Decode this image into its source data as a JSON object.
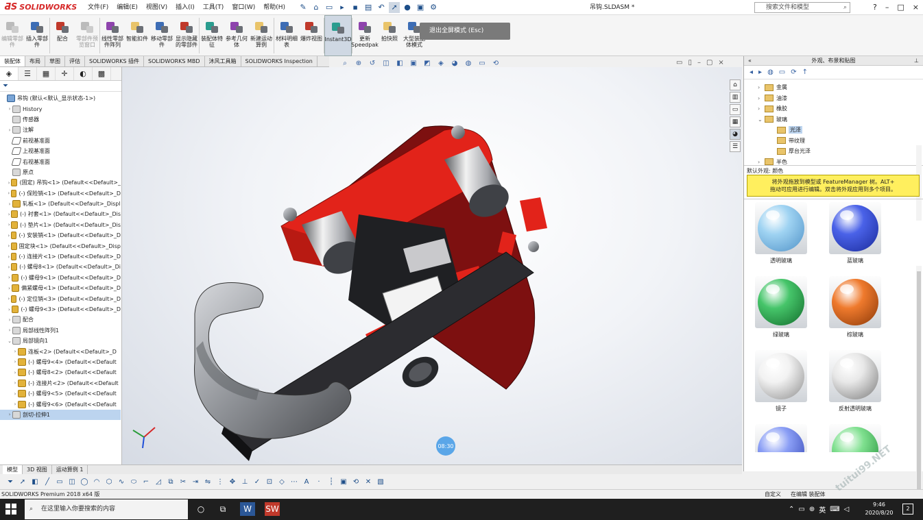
{
  "app": {
    "brand": "SOLIDWORKS",
    "doc_title": "吊钩.SLDASM *"
  },
  "menu": [
    "文件(F)",
    "编辑(E)",
    "视图(V)",
    "插入(I)",
    "工具(T)",
    "窗口(W)",
    "帮助(H)"
  ],
  "search": {
    "placeholder": "搜索文件和模型"
  },
  "win_controls": [
    "?",
    "–",
    "□",
    "×"
  ],
  "ribbon": [
    {
      "label": "编辑零部件",
      "enabled": false
    },
    {
      "label": "插入零部件",
      "enabled": true
    },
    {
      "label": "配合",
      "enabled": true
    },
    {
      "label": "零部件预览窗口",
      "enabled": false
    },
    {
      "label": "线性零部件阵列",
      "enabled": true
    },
    {
      "label": "智能扣件",
      "enabled": true
    },
    {
      "label": "移动零部件",
      "enabled": true
    },
    {
      "label": "显示隐藏的零部件",
      "enabled": true
    },
    {
      "label": "装配体特征",
      "enabled": true
    },
    {
      "label": "参考几何体",
      "enabled": true
    },
    {
      "label": "新建运动算例",
      "enabled": true
    },
    {
      "label": "材料明细表",
      "enabled": true
    },
    {
      "label": "爆炸视图",
      "enabled": true
    },
    {
      "label": "Instant3D",
      "enabled": true
    },
    {
      "label": "更新Speedpak",
      "enabled": true
    },
    {
      "label": "拍快照",
      "enabled": true
    },
    {
      "label": "大型装配体模式",
      "enabled": true
    }
  ],
  "tooltip": "退出全屏模式 (Esc)",
  "cm_tabs": [
    "装配体",
    "布局",
    "草图",
    "评估",
    "SOLIDWORKS 插件",
    "SOLIDWORKS MBD",
    "沐风工具箱",
    "SOLIDWORKS Inspection"
  ],
  "tree": [
    {
      "label": "吊钩 (默认<默认_显示状态-1>)",
      "icon": "asm",
      "indent": 0,
      "arrow": "",
      "selected": false
    },
    {
      "label": "History",
      "icon": "folder",
      "indent": 1,
      "arrow": "›",
      "selected": false
    },
    {
      "label": "传感器",
      "icon": "folder",
      "indent": 1,
      "arrow": "",
      "selected": false
    },
    {
      "label": "注解",
      "icon": "folder",
      "indent": 1,
      "arrow": "›",
      "selected": false
    },
    {
      "label": "前视基准面",
      "icon": "plane",
      "indent": 1,
      "arrow": "",
      "selected": false
    },
    {
      "label": "上视基准面",
      "icon": "plane",
      "indent": 1,
      "arrow": "",
      "selected": false
    },
    {
      "label": "右视基准面",
      "icon": "plane",
      "indent": 1,
      "arrow": "",
      "selected": false
    },
    {
      "label": "原点",
      "icon": "folder",
      "indent": 1,
      "arrow": "",
      "selected": false
    },
    {
      "label": "(固定) 吊钩<1> (Default<<Default>_",
      "icon": "part",
      "indent": 1,
      "arrow": "›",
      "selected": false
    },
    {
      "label": "(-) 保险销<1> (Default<<Default>_D",
      "icon": "part",
      "indent": 1,
      "arrow": "›",
      "selected": false
    },
    {
      "label": "轧板<1> (Default<<Default>_Displ",
      "icon": "part",
      "indent": 1,
      "arrow": "›",
      "selected": false
    },
    {
      "label": "(-) 衬套<1> (Default<<Default>_Dis",
      "icon": "part",
      "indent": 1,
      "arrow": "›",
      "selected": false
    },
    {
      "label": "(-) 垫片<1> (Default<<Default>_Dis",
      "icon": "part",
      "indent": 1,
      "arrow": "›",
      "selected": false
    },
    {
      "label": "(-) 安装销<1> (Default<<Default>_D",
      "icon": "part",
      "indent": 1,
      "arrow": "›",
      "selected": false
    },
    {
      "label": "固定块<1> (Default<<Default>_Disp",
      "icon": "part",
      "indent": 1,
      "arrow": "›",
      "selected": false
    },
    {
      "label": "(-) 连接片<1> (Default<<Default>_D",
      "icon": "part",
      "indent": 1,
      "arrow": "›",
      "selected": false
    },
    {
      "label": "(-) 螺母8<1> (Default<<Default>_Di",
      "icon": "part",
      "indent": 1,
      "arrow": "›",
      "selected": false
    },
    {
      "label": "(-) 螺母9<1> (Default<<Default>_D",
      "icon": "part",
      "indent": 1,
      "arrow": "›",
      "selected": false
    },
    {
      "label": "偏紧螺母<1> (Default<<Default>_D",
      "icon": "part",
      "indent": 1,
      "arrow": "›",
      "selected": false
    },
    {
      "label": "(-) 定位销<3> (Default<<Default>_D",
      "icon": "part",
      "indent": 1,
      "arrow": "›",
      "selected": false
    },
    {
      "label": "(-) 螺母9<3> (Default<<Default>_D",
      "icon": "part",
      "indent": 1,
      "arrow": "›",
      "selected": false
    },
    {
      "label": "配合",
      "icon": "folder",
      "indent": 1,
      "arrow": "›",
      "selected": false
    },
    {
      "label": "局部线性阵列1",
      "icon": "folder",
      "indent": 1,
      "arrow": "›",
      "selected": false
    },
    {
      "label": "局部镜向1",
      "icon": "folder",
      "indent": 1,
      "arrow": "⌄",
      "selected": false
    },
    {
      "label": "连板<2> (Default<<Default>_D",
      "icon": "part",
      "indent": 2,
      "arrow": "›",
      "selected": false
    },
    {
      "label": "(-) 螺母9<4> (Default<<Default",
      "icon": "part",
      "indent": 2,
      "arrow": "›",
      "selected": false
    },
    {
      "label": "(-) 螺母8<2> (Default<<Default",
      "icon": "part",
      "indent": 2,
      "arrow": "›",
      "selected": false
    },
    {
      "label": "(-) 连接片<2> (Default<<Default",
      "icon": "part",
      "indent": 2,
      "arrow": "›",
      "selected": false
    },
    {
      "label": "(-) 螺母9<5> (Default<<Default",
      "icon": "part",
      "indent": 2,
      "arrow": "›",
      "selected": false
    },
    {
      "label": "(-) 螺母9<6> (Default<<Default",
      "icon": "part",
      "indent": 2,
      "arrow": "›",
      "selected": false
    },
    {
      "label": "剖切-拉伸1",
      "icon": "folder",
      "indent": 1,
      "arrow": "›",
      "selected": true
    }
  ],
  "right_panel": {
    "title": "外观、布景和贴图",
    "tree": [
      {
        "label": "金属",
        "indent": 1,
        "selected": false
      },
      {
        "label": "油漆",
        "indent": 1,
        "selected": false
      },
      {
        "label": "橡胶",
        "indent": 1,
        "selected": false
      },
      {
        "label": "玻璃",
        "indent": 1,
        "selected": false
      },
      {
        "label": "光泽",
        "indent": 2,
        "selected": true
      },
      {
        "label": "带纹理",
        "indent": 2,
        "selected": false
      },
      {
        "label": "厚台光泽",
        "indent": 2,
        "selected": false
      },
      {
        "label": "半色",
        "indent": 1,
        "selected": false
      }
    ],
    "section_label": "默认外观: 颜色",
    "hint_line1": "将外观拖放到模型或 FeatureManager 树。ALT+",
    "hint_line2": "拖动可应用进行编辑。双击将外观应用到多个项目。",
    "swatches": [
      {
        "label": "透明玻璃",
        "color": "#9fd3f2",
        "deep": "#4f91c7"
      },
      {
        "label": "蓝玻璃",
        "color": "#4a62e8",
        "deep": "#1a2a9a"
      },
      {
        "label": "绿玻璃",
        "color": "#46c56a",
        "deep": "#126b2b"
      },
      {
        "label": "棕玻璃",
        "color": "#ef7a2d",
        "deep": "#8a3808"
      },
      {
        "label": "镜子",
        "color": "#f2f2f2",
        "deep": "#8d8d8d"
      },
      {
        "label": "反射透明玻璃",
        "color": "#e8e8e8",
        "deep": "#7a7a7a"
      },
      {
        "label": "",
        "color": "#8a9ef5",
        "deep": "#2d3fb0"
      },
      {
        "label": "",
        "color": "#7fe08f",
        "deep": "#1d8a33"
      }
    ]
  },
  "bottom_tabs": [
    "模型",
    "3D 视图",
    "运动算例 1"
  ],
  "status": {
    "left": "SOLIDWORKS Premium 2018 x64 版",
    "unit": "自定义",
    "mode": "在编辑 装配体"
  },
  "viewport": {
    "timer": "08:30"
  },
  "taskbar": {
    "search_placeholder": "在这里输入你要搜索的内容",
    "time": "9:46",
    "date": "2020/8/20",
    "ime": "英",
    "notif": "2"
  },
  "watermark": "tuitui99.NET",
  "colors": {
    "red": "#e2231a",
    "dark_red": "#7d1010",
    "steel": "#9b9ea3",
    "black_plate": "#2c2c30"
  }
}
